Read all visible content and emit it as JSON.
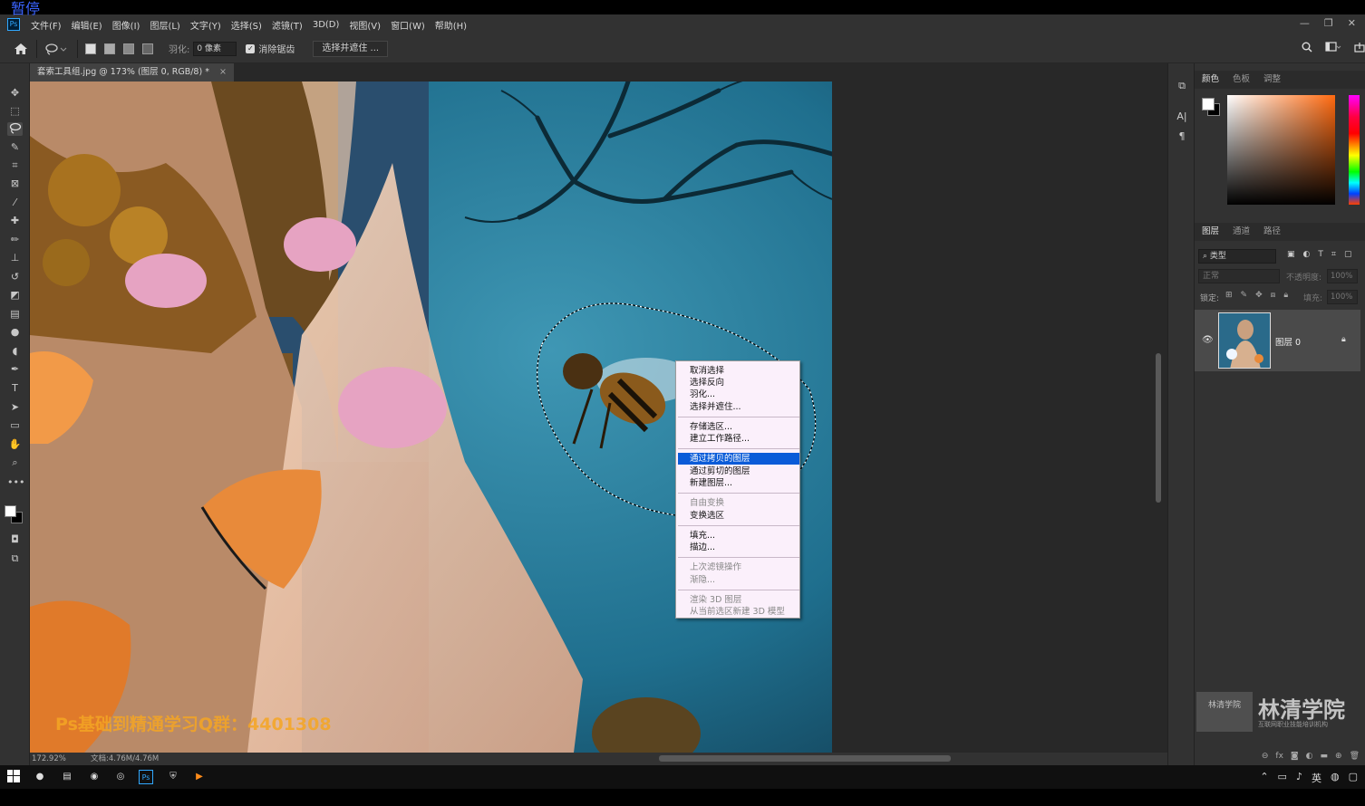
{
  "overlay": {
    "pause": "暂停"
  },
  "app": {
    "logo": "Ps"
  },
  "menu": {
    "items": [
      "文件(F)",
      "编辑(E)",
      "图像(I)",
      "图层(L)",
      "文字(Y)",
      "选择(S)",
      "滤镜(T)",
      "3D(D)",
      "视图(V)",
      "窗口(W)",
      "帮助(H)"
    ]
  },
  "window_controls": {
    "minimize": "—",
    "restore": "❐",
    "close": "✕"
  },
  "options": {
    "feather_label": "羽化:",
    "feather_value": "0 像素",
    "antialias_label": "消除锯齿",
    "antialias_checked": true,
    "select_mask_button": "选择并遮住 ..."
  },
  "document": {
    "tab_title": "套索工具组.jpg @ 173% (图层 0, RGB/8) *",
    "close": "×",
    "zoom": "172.92%",
    "doc_size": "文档:4.76M/4.76M"
  },
  "context_menu": {
    "items": [
      {
        "label": "取消选择",
        "enabled": true
      },
      {
        "label": "选择反向",
        "enabled": true
      },
      {
        "label": "羽化...",
        "enabled": true
      },
      {
        "label": "选择并遮住...",
        "enabled": true
      },
      {
        "label": "存储选区...",
        "enabled": true
      },
      {
        "label": "建立工作路径...",
        "enabled": true
      },
      {
        "label": "通过拷贝的图层",
        "enabled": true,
        "highlighted": true
      },
      {
        "label": "通过剪切的图层",
        "enabled": true
      },
      {
        "label": "新建图层...",
        "enabled": true
      },
      {
        "label": "自由变换",
        "enabled": false
      },
      {
        "label": "变换选区",
        "enabled": true
      },
      {
        "label": "填充...",
        "enabled": true
      },
      {
        "label": "描边...",
        "enabled": true
      },
      {
        "label": "上次滤镜操作",
        "enabled": false
      },
      {
        "label": "渐隐...",
        "enabled": false
      },
      {
        "label": "渲染 3D 图层",
        "enabled": false
      },
      {
        "label": "从当前选区新建 3D 模型",
        "enabled": false
      }
    ]
  },
  "color_panel": {
    "tabs": [
      "颜色",
      "色板",
      "调整"
    ],
    "active": "颜色"
  },
  "layers_panel": {
    "tabs": [
      "图层",
      "通道",
      "路径"
    ],
    "active": "图层",
    "filter_label": "类型",
    "blend_mode": "正常",
    "opacity_label": "不透明度:",
    "opacity_value": "100%",
    "lock_label": "锁定:",
    "fill_label": "填充:",
    "fill_value": "100%",
    "layers": [
      {
        "name": "图层 0",
        "visible": true,
        "locked": true
      }
    ]
  },
  "watermark": {
    "logo_text": "林清学院",
    "title": "林清学院",
    "subtitle": "互联网职业技能培训机构"
  },
  "overlay_text": "Ps基础到精通学习Q群：4401308",
  "taskbar": {
    "ime": "英"
  },
  "colors": {
    "panel_bg": "#323232",
    "canvas_bg": "#282828",
    "menu_bg": "#fbf0fb",
    "highlight": "#0a5bd8",
    "brand_blue": "#31a8ff"
  }
}
